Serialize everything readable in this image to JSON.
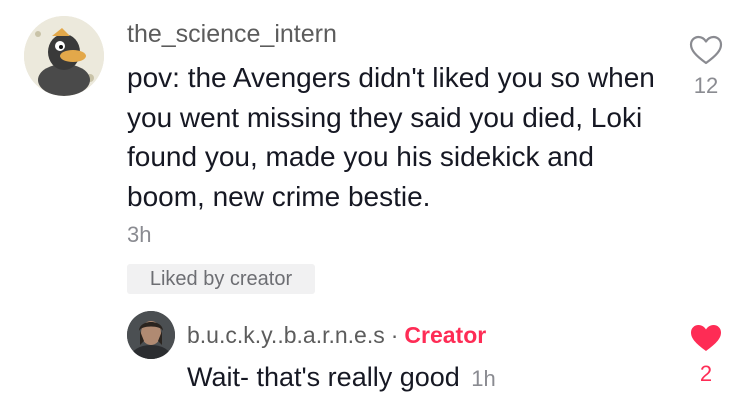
{
  "comment": {
    "username": "the_science_intern",
    "text": "pov: the Avengers didn't liked you so when you went missing they said you died, Loki found you, made you his sidekick and boom, new crime bestie.",
    "time": "3h",
    "liked_by_creator_label": "Liked by creator",
    "like_count": "12",
    "like_icon": "heart-outline-icon",
    "avatar_icon": "cartoon-duck-avatar"
  },
  "reply": {
    "username": "b.u.c.k.y..b.a.r.n.e.s",
    "separator": "·",
    "creator_label": "Creator",
    "text": "Wait- that's really good",
    "time": "1h",
    "like_count": "2",
    "like_icon": "heart-filled-icon",
    "avatar_icon": "person-avatar"
  },
  "colors": {
    "accent": "#fe2c55",
    "secondary_text": "#8a8b91",
    "primary_text": "#161823",
    "badge_bg": "#f1f1f2"
  }
}
